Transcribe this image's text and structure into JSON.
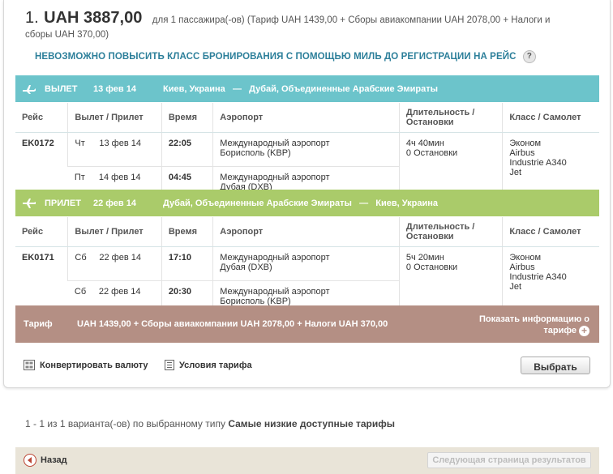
{
  "offer": {
    "number": "1.",
    "price": "UAH 3887,00",
    "desc_line1": "для 1 пассажира(-ов) (Тариф UAH 1439,00 + Сборы авиакомпании UAH 2078,00 + Налоги и",
    "desc_line2": "сборы UAH 370,00)",
    "upgrade_notice": "Невозможно повысить класс бронирования с помощью миль до регистрации на рейс",
    "help_icon": "?"
  },
  "columns": {
    "flight": "Рейс",
    "depart_arrive": "Вылет / Прилет",
    "time": "Время",
    "airport": "Аэропорт",
    "duration_l1": "Длительность /",
    "duration_l2": "Остановки",
    "class_plane": "Класс / Самолет"
  },
  "outbound": {
    "label": "ВЫЛЕТ",
    "date": "13 фев 14",
    "from": "Киев, Украина",
    "dash": "—",
    "to": "Дубай, Объединенные Арабские Эмираты",
    "flight_no": "EK0172",
    "seg1": {
      "day": "Чт",
      "date": "13 фев 14",
      "time": "22:05",
      "airport_l1": "Международный аэропорт",
      "airport_l2": "Борисполь (KBP)"
    },
    "seg2": {
      "day": "Пт",
      "date": "14 фев 14",
      "time": "04:45",
      "airport_l1": "Международный аэропорт",
      "airport_l2": "Дубая (DXB)"
    },
    "duration": "4ч 40мин",
    "stops": "0 Остановки",
    "class": "Эконом",
    "plane_l1": "Airbus",
    "plane_l2": "Industrie A340",
    "plane_l3": "Jet"
  },
  "inbound": {
    "label": "ПРИЛЕТ",
    "date": "22 фев 14",
    "from": "Дубай, Объединенные Арабские Эмираты",
    "dash": "—",
    "to": "Киев, Украина",
    "flight_no": "EK0171",
    "seg1": {
      "day": "Сб",
      "date": "22 фев 14",
      "time": "17:10",
      "airport_l1": "Международный аэропорт",
      "airport_l2": "Дубая (DXB)"
    },
    "seg2": {
      "day": "Сб",
      "date": "22 фев 14",
      "time": "20:30",
      "airport_l1": "Международный аэропорт",
      "airport_l2": "Борисполь (KBP)"
    },
    "duration": "5ч 20мин",
    "stops": "0 Остановки",
    "class": "Эконом",
    "plane_l1": "Airbus",
    "plane_l2": "Industrie A340",
    "plane_l3": "Jet"
  },
  "fare": {
    "label": "Тариф",
    "text": "UAH 1439,00 + Сборы авиакомпании UAH 2078,00 + Налоги UAH 370,00",
    "more_l1": "Показать информацию о",
    "more_l2": "тарифе",
    "plus": "+"
  },
  "actions": {
    "convert": "Конвертировать валюту",
    "conditions": "Условия тарифа",
    "select": "Выбрать"
  },
  "results": {
    "prefix": "1 - 1 из 1 варианта(-ов) по выбранному типу",
    "type": "Самые низкие доступные тарифы"
  },
  "nav": {
    "back": "Назад",
    "next": "Следующая страница результатов"
  },
  "colors": {
    "departure_band": "#6cc4cb",
    "arrival_band": "#aacb6a",
    "fare_band": "#b48f84",
    "accent_text": "#2c7f9a"
  }
}
